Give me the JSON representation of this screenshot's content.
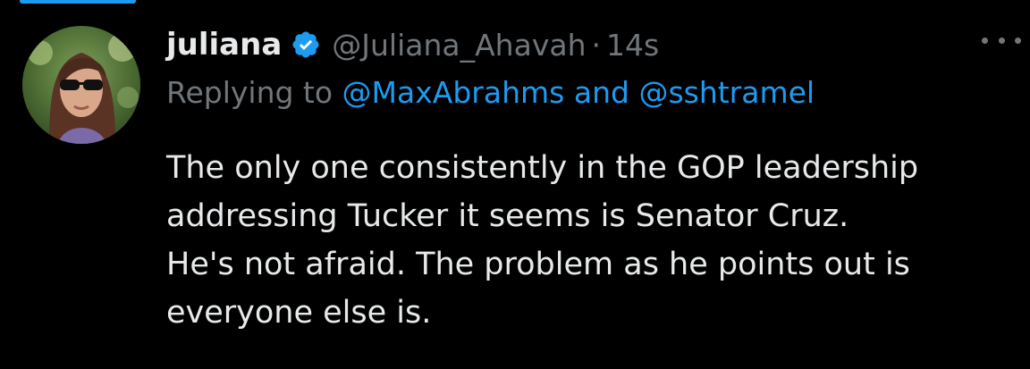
{
  "tweet": {
    "author": {
      "display_name": "juliana",
      "handle": "@Juliana_Ahavah",
      "verified_icon": "verified-badge-icon",
      "avatar": "avatar"
    },
    "separator": "·",
    "timestamp": "14s",
    "more_icon": "more-options-icon",
    "reply": {
      "prefix": "Replying to",
      "mention_1": "@MaxAbrahms",
      "conjunction": "and",
      "mention_2": "@sshtramel"
    },
    "text_lines": [
      "The only one consistently in the GOP leadership",
      "addressing Tucker it seems is Senator Cruz.",
      "He's not afraid. The problem as he points out is",
      "everyone else is."
    ]
  },
  "colors": {
    "background": "#000000",
    "primary_text": "#e7e9ea",
    "secondary_text": "#71767b",
    "accent": "#1d9bf0"
  }
}
